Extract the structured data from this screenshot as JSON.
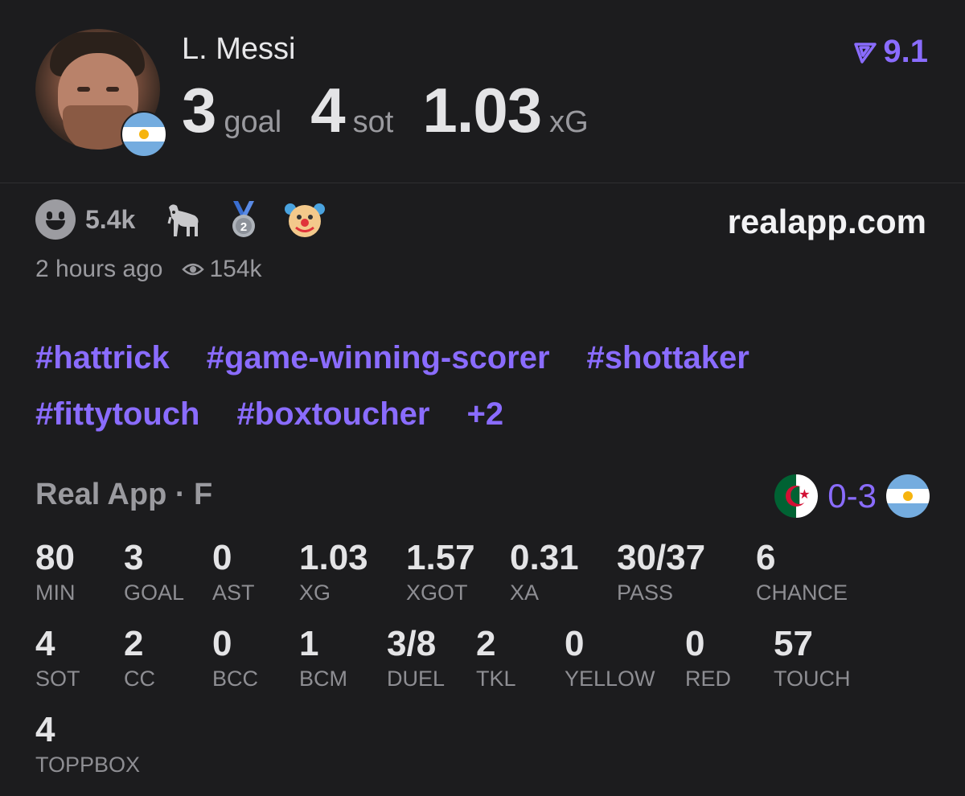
{
  "player": {
    "name": "L. Messi",
    "rating": "9.1",
    "headline": [
      {
        "value": "3",
        "unit": "goal"
      },
      {
        "value": "4",
        "unit": "sot"
      },
      {
        "value": "1.03",
        "unit": "xG"
      }
    ]
  },
  "social": {
    "reaction_count": "5.4k",
    "emojis": [
      "goat-emoji",
      "silver-medal-emoji",
      "clown-emoji"
    ],
    "site": "realapp.com",
    "time_ago": "2 hours ago",
    "views": "154k"
  },
  "tags": {
    "row1": [
      "#hattrick",
      "#game-winning-scorer",
      "#shottaker"
    ],
    "row2": [
      "#fittytouch",
      "#boxtoucher",
      "+2"
    ]
  },
  "match": {
    "title": "Real App · F",
    "score": "0-3",
    "home_flag": "algeria-flag-icon",
    "away_flag": "argentina-flag-icon"
  },
  "stats": [
    {
      "value": "80",
      "label": "MIN"
    },
    {
      "value": "3",
      "label": "GOAL"
    },
    {
      "value": "0",
      "label": "AST"
    },
    {
      "value": "1.03",
      "label": "XG"
    },
    {
      "value": "1.57",
      "label": "XGOT"
    },
    {
      "value": "0.31",
      "label": "XA"
    },
    {
      "value": "30/37",
      "label": "PASS"
    },
    {
      "value": "6",
      "label": "CHANCE"
    },
    {
      "value": "4",
      "label": "SOT"
    },
    {
      "value": "2",
      "label": "CC"
    },
    {
      "value": "0",
      "label": "BCC"
    },
    {
      "value": "1",
      "label": "BCM"
    },
    {
      "value": "3/8",
      "label": "DUEL"
    },
    {
      "value": "2",
      "label": "TKL"
    },
    {
      "value": "0",
      "label": "YELLOW"
    },
    {
      "value": "0",
      "label": "RED"
    },
    {
      "value": "57",
      "label": "TOUCH"
    },
    {
      "value": "4",
      "label": "TOPPBOX"
    }
  ],
  "colors": {
    "background": "#1c1c1e",
    "accent": "#8a6cff",
    "muted": "#8e8e93"
  }
}
